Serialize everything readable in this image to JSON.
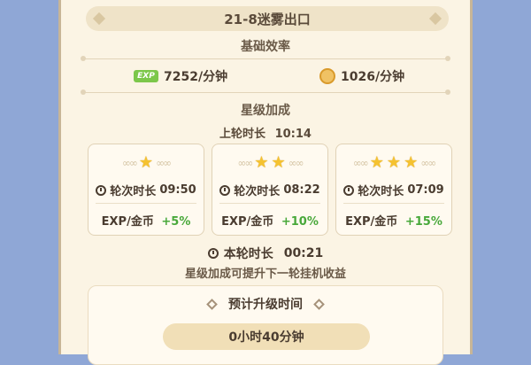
{
  "stage": {
    "title": "21-8迷雾出口"
  },
  "base_efficiency": {
    "heading": "基础效率",
    "exp_icon_label": "EXP",
    "exp_rate": "7252/分钟",
    "gold_rate": "1026/分钟"
  },
  "star_bonus": {
    "heading": "星级加成",
    "prev_round_label": "上轮时长",
    "prev_round_value": "10:14",
    "cards": [
      {
        "stars": 1,
        "round_label": "轮次时长",
        "round_time": "09:50",
        "bonus_label": "EXP/金币",
        "bonus_value": "+5%"
      },
      {
        "stars": 2,
        "round_label": "轮次时长",
        "round_time": "08:22",
        "bonus_label": "EXP/金币",
        "bonus_value": "+10%"
      },
      {
        "stars": 3,
        "round_label": "轮次时长",
        "round_time": "07:09",
        "bonus_label": "EXP/金币",
        "bonus_value": "+15%"
      }
    ],
    "current_round_label": "本轮时长",
    "current_round_value": "00:21",
    "hint": "星级加成可提升下一轮挂机收益"
  },
  "estimate": {
    "heading": "预计升级时间",
    "value": "0小时40分钟"
  },
  "icons": [
    "exp-icon",
    "gold-coin-icon",
    "star-icon",
    "clock-icon",
    "diamond-icon"
  ],
  "colors": {
    "panel_bg": "#fbf4e4",
    "outer_bg": "#8fa7d6",
    "star": "#f5c230",
    "bonus_green": "#48a83a",
    "exp_green": "#7cc74a"
  }
}
